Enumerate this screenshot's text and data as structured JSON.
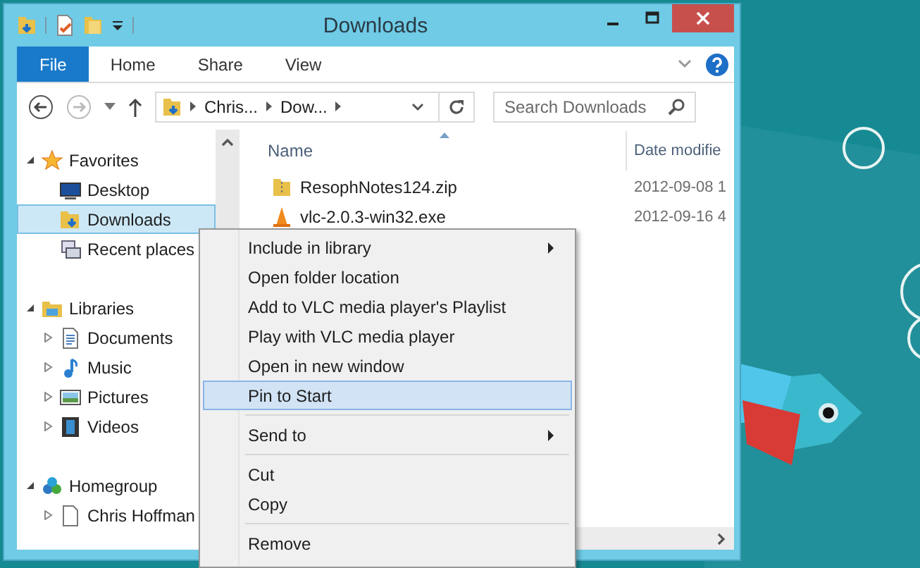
{
  "window": {
    "title": "Downloads"
  },
  "ribbon_tabs": [
    {
      "label": "File",
      "kind": "file",
      "selected": false
    },
    {
      "label": "Home",
      "kind": "tab",
      "selected": false
    },
    {
      "label": "Share",
      "kind": "tab",
      "selected": false
    },
    {
      "label": "View",
      "kind": "tab",
      "selected": false
    }
  ],
  "address_bar": {
    "crumbs": [
      "Chris...",
      "Dow..."
    ]
  },
  "search": {
    "placeholder": "Search Downloads"
  },
  "navigation": [
    {
      "label": "Favorites",
      "expanded": true,
      "children": [
        {
          "label": "Desktop",
          "selected": false
        },
        {
          "label": "Downloads",
          "selected": true
        },
        {
          "label": "Recent places",
          "selected": false
        }
      ]
    },
    {
      "label": "Libraries",
      "expanded": true,
      "children": [
        {
          "label": "Documents",
          "selected": false,
          "expanded": false
        },
        {
          "label": "Music",
          "selected": false,
          "expanded": false
        },
        {
          "label": "Pictures",
          "selected": false,
          "expanded": false
        },
        {
          "label": "Videos",
          "selected": false,
          "expanded": false
        }
      ]
    },
    {
      "label": "Homegroup",
      "expanded": true,
      "children": [
        {
          "label": "Chris Hoffman",
          "selected": false,
          "expanded": false
        }
      ]
    }
  ],
  "file_list": {
    "columns": [
      "Name",
      "Date modifie"
    ],
    "rows": [
      {
        "name": "ResophNotes124.zip",
        "date": "2012-09-08 1"
      },
      {
        "name": "vlc-2.0.3-win32.exe",
        "date": "2012-09-16 4"
      }
    ]
  },
  "context_menu": [
    {
      "kind": "item",
      "label": "Include in library",
      "submenu": true,
      "selected": false
    },
    {
      "kind": "item",
      "label": "Open folder location",
      "submenu": false,
      "selected": false
    },
    {
      "kind": "item",
      "label": "Add to VLC media player's Playlist",
      "submenu": false,
      "selected": false
    },
    {
      "kind": "item",
      "label": "Play with VLC media player",
      "submenu": false,
      "selected": false
    },
    {
      "kind": "item",
      "label": "Open in new window",
      "submenu": false,
      "selected": false
    },
    {
      "kind": "item",
      "label": "Pin to Start",
      "submenu": false,
      "selected": true
    },
    {
      "kind": "separator"
    },
    {
      "kind": "item",
      "label": "Send to",
      "submenu": true,
      "selected": false
    },
    {
      "kind": "separator"
    },
    {
      "kind": "item",
      "label": "Cut",
      "submenu": false,
      "selected": false
    },
    {
      "kind": "item",
      "label": "Copy",
      "submenu": false,
      "selected": false
    },
    {
      "kind": "separator"
    },
    {
      "kind": "item",
      "label": "Remove",
      "submenu": false,
      "selected": false
    }
  ]
}
